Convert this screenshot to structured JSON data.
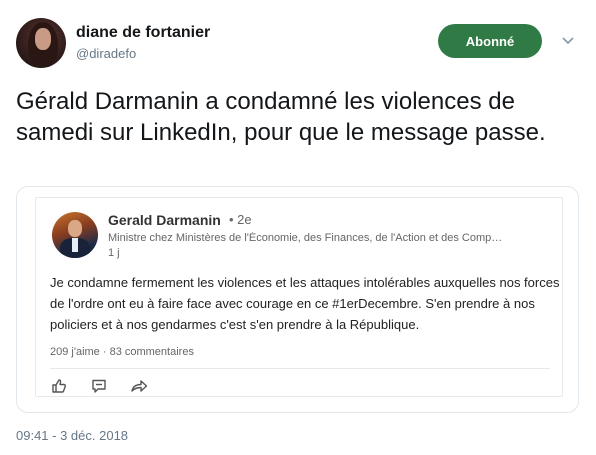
{
  "author": {
    "name": "diane de fortanier",
    "handle": "@diradefo",
    "follow_label": "Abonné"
  },
  "tweet": {
    "text": "Gérald Darmanin a condamné les violences de samedi sur LinkedIn, pour que le message passe.",
    "timestamp": "09:41 - 3 déc. 2018"
  },
  "linkedin_post": {
    "name": "Gerald Darmanin",
    "degree": "• 2e",
    "headline": "Ministre chez Ministères de l'Économie, des Finances, de l'Action et des Comp…",
    "time": "1 j",
    "body": "Je condamne fermement les violences et les attaques intolérables auxquelles nos forces de l'ordre ont eu à faire face avec courage en ce #1erDecembre. S'en prendre à nos policiers et à nos gendarmes c'est s'en prendre à la République.",
    "stats": "209 j'aime · 83 commentaires",
    "actions": [
      "like-icon",
      "comment-icon",
      "share-icon"
    ]
  },
  "colors": {
    "follow_button": "#2f7a45",
    "muted_text": "#657786"
  }
}
